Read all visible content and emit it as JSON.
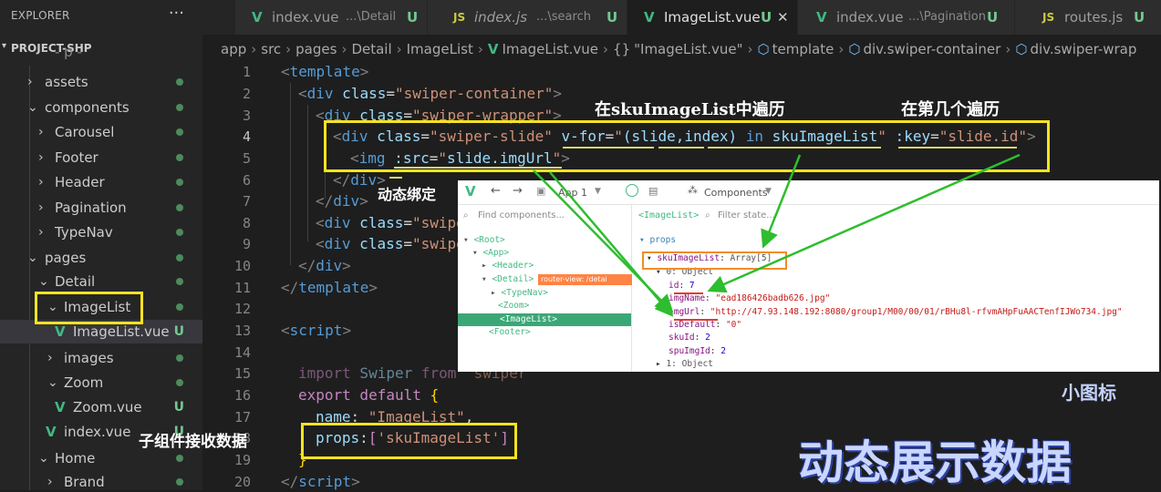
{
  "sidebar": {
    "title": "EXPLORER",
    "more": "···",
    "project": "PROJECT-SHP",
    "items": [
      {
        "label": "assets"
      },
      {
        "label": "components"
      },
      {
        "label": "Carousel"
      },
      {
        "label": "Footer"
      },
      {
        "label": "Header"
      },
      {
        "label": "Pagination"
      },
      {
        "label": "TypeNav"
      },
      {
        "label": "pages"
      },
      {
        "label": "Detail"
      },
      {
        "label": "ImageList"
      },
      {
        "label": "ImageList.vue",
        "status": "U"
      },
      {
        "label": "images"
      },
      {
        "label": "Zoom"
      },
      {
        "label": "Zoom.vue",
        "status": "U"
      },
      {
        "label": "index.vue",
        "status": "U"
      },
      {
        "label": "Home"
      },
      {
        "label": "Brand"
      }
    ]
  },
  "tabs": [
    {
      "icon": "V",
      "name": "index.vue",
      "path": "...\\Detail",
      "status": "U"
    },
    {
      "icon": "JS",
      "name": "index.js",
      "path": "...\\search",
      "status": "U"
    },
    {
      "icon": "V",
      "name": "ImageList.vue",
      "path": "",
      "status": "U"
    },
    {
      "icon": "V",
      "name": "index.vue",
      "path": "...\\Pagination",
      "status": "U"
    },
    {
      "icon": "JS",
      "name": "routes.js",
      "path": "",
      "status": "U"
    }
  ],
  "breadcrumb": [
    "app",
    "src",
    "pages",
    "Detail",
    "ImageList",
    "ImageList.vue",
    "\"ImageList.vue\"",
    "template",
    "div.swiper-container",
    "div.swiper-wrap"
  ],
  "breadcrumb_braces": "{}",
  "code": {
    "line_numbers": [
      "1",
      "2",
      "3",
      "4",
      "5",
      "6",
      "7",
      "8",
      "9",
      "10",
      "11",
      "12",
      "13",
      "14",
      "15",
      "16",
      "17",
      "18",
      "19",
      "20"
    ],
    "l1": {
      "open": "<",
      "tag": "template",
      "close": ">"
    },
    "l2": {
      "open": "<",
      "tag": "div",
      "attr": " class",
      "eq": "=",
      "val": "\"swiper-container\"",
      "close": ">"
    },
    "l3": {
      "open": "<",
      "tag": "div",
      "attr": " class",
      "eq": "=",
      "val": "\"swiper-wrapper\"",
      "close": ">"
    },
    "l4": {
      "open": "<",
      "tag": "div",
      "attr": " class",
      "eq": "=",
      "val": "\"swiper-slide\"",
      "vfor": " v-for",
      "eq2": "=",
      "q1": "\"",
      "expr1": "(slide,index) ",
      "in": "in",
      "expr2": " skuImageList",
      "q2": "\"",
      "key": " :key",
      "eq3": "=",
      "keyval": "\"slide.id\"",
      "close": ">"
    },
    "l5": {
      "open": "<",
      "tag": "img",
      "attr": " :src",
      "eq": "=",
      "q1": "\"",
      "expr": "slide.imgUrl",
      "q2": "\"",
      "close": ">"
    },
    "l6": {
      "open": "</",
      "tag": "div",
      "close": ">"
    },
    "l7": {
      "open": "</",
      "tag": "div",
      "close": ">"
    },
    "l8": {
      "open": "<",
      "tag": "div",
      "attr": " class",
      "eq": "=",
      "val": "\"swipe"
    },
    "l9": {
      "open": "<",
      "tag": "div",
      "attr": " class",
      "eq": "=",
      "val": "\"swipe"
    },
    "l10": {
      "open": "</",
      "tag": "div",
      "close": ">"
    },
    "l11": {
      "open": "</",
      "tag": "template",
      "close": ">"
    },
    "l13": {
      "open": "<",
      "tag": "script",
      "close": ">"
    },
    "l15": {
      "kw": "import",
      "name": " Swiper ",
      "from": "from",
      "rest": " 'swiper"
    },
    "l16": {
      "kw": "export",
      "kw2": " default ",
      "brace": "{"
    },
    "l17": {
      "key": "name",
      "colon": ": ",
      "val": "\"ImageList\"",
      "comma": ","
    },
    "l18": {
      "key": "props",
      "colon": ":",
      "b1": "[",
      "val": "'skuImageList'",
      "b2": "]"
    },
    "l19": {
      "brace": "}"
    },
    "l20": {
      "open": "</",
      "tag": "script",
      "close": ">"
    }
  },
  "annotations": {
    "traverse": "在skuImageList中遍历",
    "which": "在第几个遍历",
    "dynamic_bind": "动态绑定",
    "small_icon": "小图标",
    "child_receive": "子组件接收数据",
    "dynamic_show": "动态展示数据"
  },
  "devtools": {
    "app_selector": "App 1",
    "components_tab": "Components",
    "find_placeholder": "Find components...",
    "selected_component": "<ImageList>",
    "filter_placeholder": "Filter state...",
    "tree": [
      {
        "label": "<Root>"
      },
      {
        "label": "<App>"
      },
      {
        "label": "<Header>"
      },
      {
        "label": "<Detail>",
        "badge": "router-view: /detai"
      },
      {
        "label": "<TypeNav>"
      },
      {
        "label": "<Zoom>"
      },
      {
        "label": "<ImageList>"
      },
      {
        "label": "<Footer>"
      }
    ],
    "props_section": "props",
    "props": {
      "list_key": "skuImageList",
      "list_type": "Array[5]",
      "item0": "0: Object",
      "id_key": "id",
      "id_val": "7",
      "imgName_key": "imgName",
      "imgName_val": "\"ead186426badb626.jpg\"",
      "imgUrl_key": "imgUrl",
      "imgUrl_val": "\"http://47.93.148.192:8080/group1/M00/00/01/rBHu8l-rfvmAHpFuAACTenfIJWo734.jpg\"",
      "isDefault_key": "isDefault",
      "isDefault_val": "\"0\"",
      "skuId_key": "skuId",
      "skuId_val": "2",
      "spuImgId_key": "spuImgId",
      "spuImgId_val": "2",
      "item1": "1: Object"
    }
  }
}
